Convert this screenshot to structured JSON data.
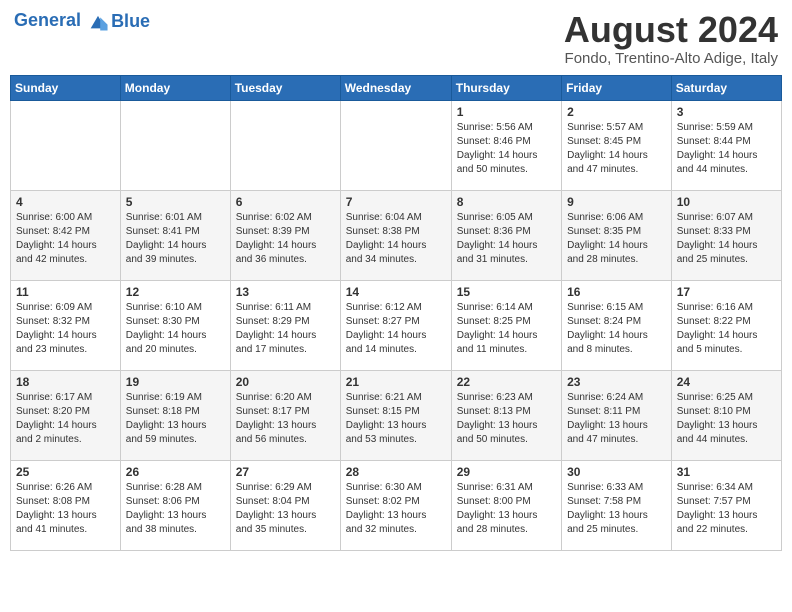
{
  "header": {
    "logo_line1": "General",
    "logo_line2": "Blue",
    "month_year": "August 2024",
    "location": "Fondo, Trentino-Alto Adige, Italy"
  },
  "weekdays": [
    "Sunday",
    "Monday",
    "Tuesday",
    "Wednesday",
    "Thursday",
    "Friday",
    "Saturday"
  ],
  "weeks": [
    [
      {
        "day": "",
        "sunrise": "",
        "sunset": "",
        "daylight": ""
      },
      {
        "day": "",
        "sunrise": "",
        "sunset": "",
        "daylight": ""
      },
      {
        "day": "",
        "sunrise": "",
        "sunset": "",
        "daylight": ""
      },
      {
        "day": "",
        "sunrise": "",
        "sunset": "",
        "daylight": ""
      },
      {
        "day": "1",
        "sunrise": "5:56 AM",
        "sunset": "8:46 PM",
        "daylight": "14 hours and 50 minutes."
      },
      {
        "day": "2",
        "sunrise": "5:57 AM",
        "sunset": "8:45 PM",
        "daylight": "14 hours and 47 minutes."
      },
      {
        "day": "3",
        "sunrise": "5:59 AM",
        "sunset": "8:44 PM",
        "daylight": "14 hours and 44 minutes."
      }
    ],
    [
      {
        "day": "4",
        "sunrise": "6:00 AM",
        "sunset": "8:42 PM",
        "daylight": "14 hours and 42 minutes."
      },
      {
        "day": "5",
        "sunrise": "6:01 AM",
        "sunset": "8:41 PM",
        "daylight": "14 hours and 39 minutes."
      },
      {
        "day": "6",
        "sunrise": "6:02 AM",
        "sunset": "8:39 PM",
        "daylight": "14 hours and 36 minutes."
      },
      {
        "day": "7",
        "sunrise": "6:04 AM",
        "sunset": "8:38 PM",
        "daylight": "14 hours and 34 minutes."
      },
      {
        "day": "8",
        "sunrise": "6:05 AM",
        "sunset": "8:36 PM",
        "daylight": "14 hours and 31 minutes."
      },
      {
        "day": "9",
        "sunrise": "6:06 AM",
        "sunset": "8:35 PM",
        "daylight": "14 hours and 28 minutes."
      },
      {
        "day": "10",
        "sunrise": "6:07 AM",
        "sunset": "8:33 PM",
        "daylight": "14 hours and 25 minutes."
      }
    ],
    [
      {
        "day": "11",
        "sunrise": "6:09 AM",
        "sunset": "8:32 PM",
        "daylight": "14 hours and 23 minutes."
      },
      {
        "day": "12",
        "sunrise": "6:10 AM",
        "sunset": "8:30 PM",
        "daylight": "14 hours and 20 minutes."
      },
      {
        "day": "13",
        "sunrise": "6:11 AM",
        "sunset": "8:29 PM",
        "daylight": "14 hours and 17 minutes."
      },
      {
        "day": "14",
        "sunrise": "6:12 AM",
        "sunset": "8:27 PM",
        "daylight": "14 hours and 14 minutes."
      },
      {
        "day": "15",
        "sunrise": "6:14 AM",
        "sunset": "8:25 PM",
        "daylight": "14 hours and 11 minutes."
      },
      {
        "day": "16",
        "sunrise": "6:15 AM",
        "sunset": "8:24 PM",
        "daylight": "14 hours and 8 minutes."
      },
      {
        "day": "17",
        "sunrise": "6:16 AM",
        "sunset": "8:22 PM",
        "daylight": "14 hours and 5 minutes."
      }
    ],
    [
      {
        "day": "18",
        "sunrise": "6:17 AM",
        "sunset": "8:20 PM",
        "daylight": "14 hours and 2 minutes."
      },
      {
        "day": "19",
        "sunrise": "6:19 AM",
        "sunset": "8:18 PM",
        "daylight": "13 hours and 59 minutes."
      },
      {
        "day": "20",
        "sunrise": "6:20 AM",
        "sunset": "8:17 PM",
        "daylight": "13 hours and 56 minutes."
      },
      {
        "day": "21",
        "sunrise": "6:21 AM",
        "sunset": "8:15 PM",
        "daylight": "13 hours and 53 minutes."
      },
      {
        "day": "22",
        "sunrise": "6:23 AM",
        "sunset": "8:13 PM",
        "daylight": "13 hours and 50 minutes."
      },
      {
        "day": "23",
        "sunrise": "6:24 AM",
        "sunset": "8:11 PM",
        "daylight": "13 hours and 47 minutes."
      },
      {
        "day": "24",
        "sunrise": "6:25 AM",
        "sunset": "8:10 PM",
        "daylight": "13 hours and 44 minutes."
      }
    ],
    [
      {
        "day": "25",
        "sunrise": "6:26 AM",
        "sunset": "8:08 PM",
        "daylight": "13 hours and 41 minutes."
      },
      {
        "day": "26",
        "sunrise": "6:28 AM",
        "sunset": "8:06 PM",
        "daylight": "13 hours and 38 minutes."
      },
      {
        "day": "27",
        "sunrise": "6:29 AM",
        "sunset": "8:04 PM",
        "daylight": "13 hours and 35 minutes."
      },
      {
        "day": "28",
        "sunrise": "6:30 AM",
        "sunset": "8:02 PM",
        "daylight": "13 hours and 32 minutes."
      },
      {
        "day": "29",
        "sunrise": "6:31 AM",
        "sunset": "8:00 PM",
        "daylight": "13 hours and 28 minutes."
      },
      {
        "day": "30",
        "sunrise": "6:33 AM",
        "sunset": "7:58 PM",
        "daylight": "13 hours and 25 minutes."
      },
      {
        "day": "31",
        "sunrise": "6:34 AM",
        "sunset": "7:57 PM",
        "daylight": "13 hours and 22 minutes."
      }
    ]
  ],
  "row_styles": [
    "row-white",
    "row-gray",
    "row-white",
    "row-gray",
    "row-white"
  ]
}
